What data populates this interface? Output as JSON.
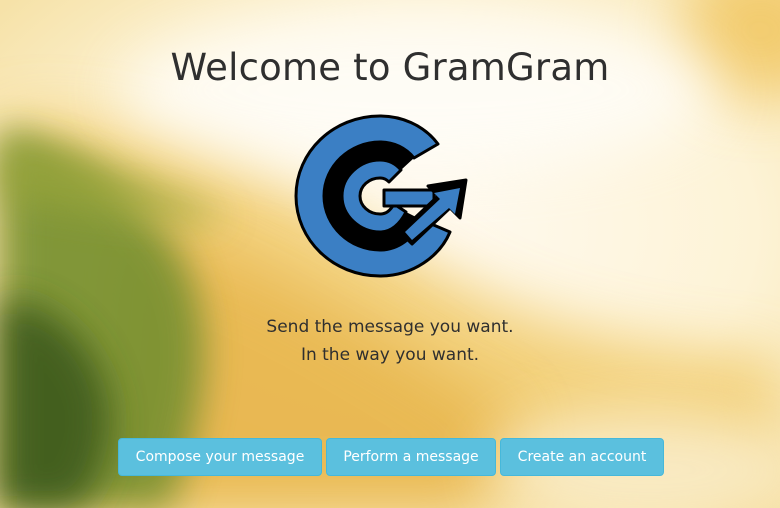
{
  "page": {
    "title": "Welcome to GramGram",
    "logo_icon": "gramgram-logo-icon",
    "tagline_line1": "Send the message you want.",
    "tagline_line2": "In the way you want."
  },
  "actions": {
    "compose_label": "Compose your message",
    "perform_label": "Perform a message",
    "create_account_label": "Create an account"
  },
  "colors": {
    "button_bg": "#5bc0de",
    "button_border": "#46b8da",
    "logo_blue": "#3b7fc4",
    "logo_black": "#000000"
  }
}
